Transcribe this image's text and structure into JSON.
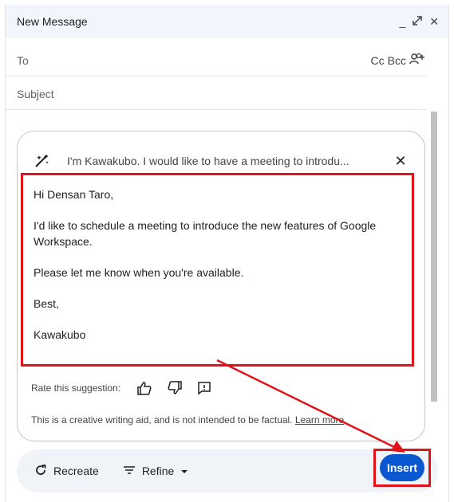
{
  "window": {
    "title": "New Message"
  },
  "header_icons": {
    "minimize": "_",
    "expand": "⤢",
    "close": "✕"
  },
  "fields": {
    "to_label": "To",
    "cc_label": "Cc",
    "bcc_label": "Bcc",
    "subject_label": "Subject"
  },
  "help_me_write": {
    "prompt": "I'm Kawakubo. I would like to have a meeting to introdu...",
    "close_glyph": "✕",
    "suggestion": {
      "greeting": "Hi Densan Taro,",
      "body": "I'd like to schedule a meeting to introduce the new features of Google Workspace.",
      "request": "Please let me know when you're available.",
      "closing": "Best,",
      "signature": "Kawakubo"
    },
    "rate_label": "Rate this suggestion:",
    "disclaimer": "This is a creative writing aid, and is not intended to be factual.",
    "learn_more": "Learn more"
  },
  "actions": {
    "recreate_label": "Recreate",
    "refine_label": "Refine",
    "insert_label": "Insert"
  },
  "colors": {
    "highlight": "#e0131a",
    "primary": "#0b57d0",
    "header_bg": "#f2f6fc"
  }
}
